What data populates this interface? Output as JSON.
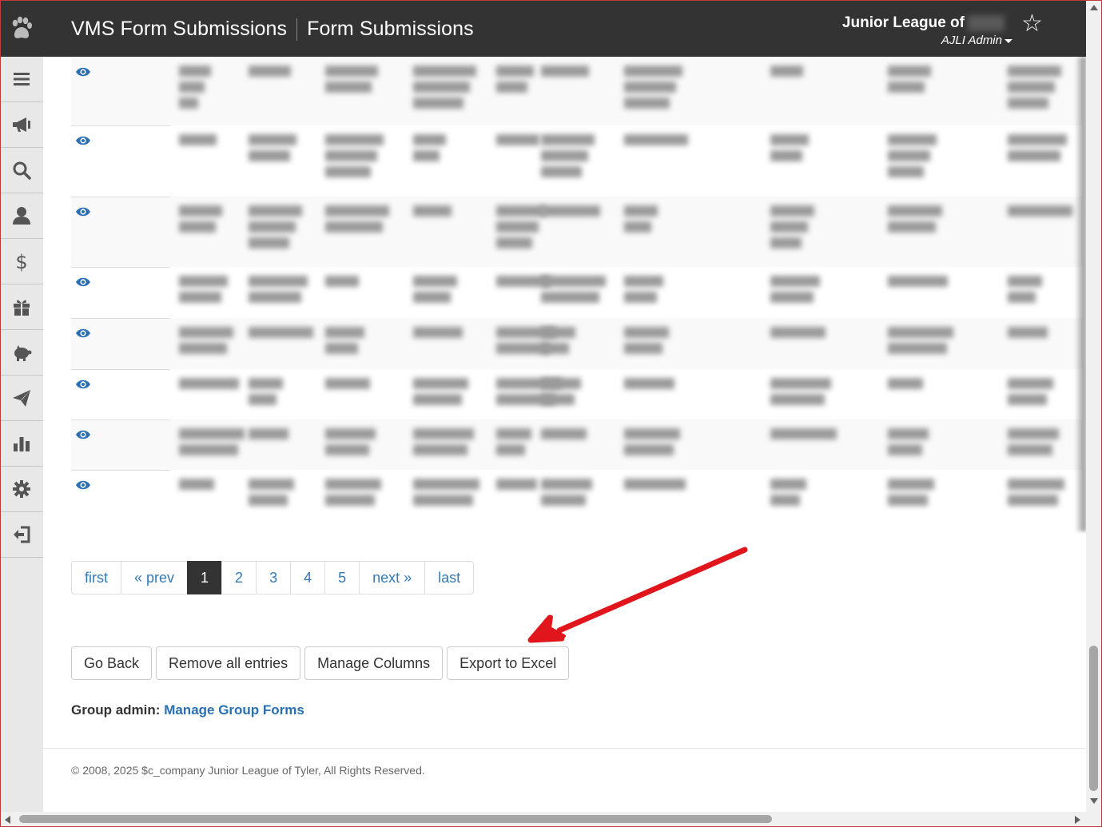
{
  "header": {
    "app_title": "VMS Form Submissions",
    "page_title": "Form Submissions",
    "org_name": "Junior League of",
    "user_role": "AJLI Admin"
  },
  "sidebar": {
    "items": [
      {
        "icon": "menu-icon"
      },
      {
        "icon": "megaphone-icon"
      },
      {
        "icon": "search-icon"
      },
      {
        "icon": "user-icon"
      },
      {
        "icon": "dollar-icon"
      },
      {
        "icon": "gift-icon"
      },
      {
        "icon": "piggy-bank-icon"
      },
      {
        "icon": "paper-plane-icon"
      },
      {
        "icon": "bar-chart-icon"
      },
      {
        "icon": "gear-icon"
      },
      {
        "icon": "sign-out-icon"
      }
    ]
  },
  "table": {
    "rows": [
      {
        "striped": true
      },
      {
        "striped": false
      },
      {
        "striped": true
      },
      {
        "striped": false
      },
      {
        "striped": true
      },
      {
        "striped": false
      },
      {
        "striped": true
      },
      {
        "striped": false
      }
    ]
  },
  "pagination": {
    "first": "first",
    "prev": "« prev",
    "pages": [
      "1",
      "2",
      "3",
      "4",
      "5"
    ],
    "active_page": "1",
    "next": "next »",
    "last": "last"
  },
  "actions": {
    "go_back": "Go Back",
    "remove_all": "Remove all entries",
    "manage_columns": "Manage Columns",
    "export_excel": "Export to Excel"
  },
  "group_admin": {
    "label": "Group admin:",
    "link": "Manage Group Forms"
  },
  "footer": {
    "copyright": "© 2008, 2025 $c_company Junior League of Tyler, All Rights Reserved."
  },
  "colors": {
    "header_bg": "#333333",
    "link": "#337ab7",
    "annotation_arrow": "#e0161c"
  }
}
